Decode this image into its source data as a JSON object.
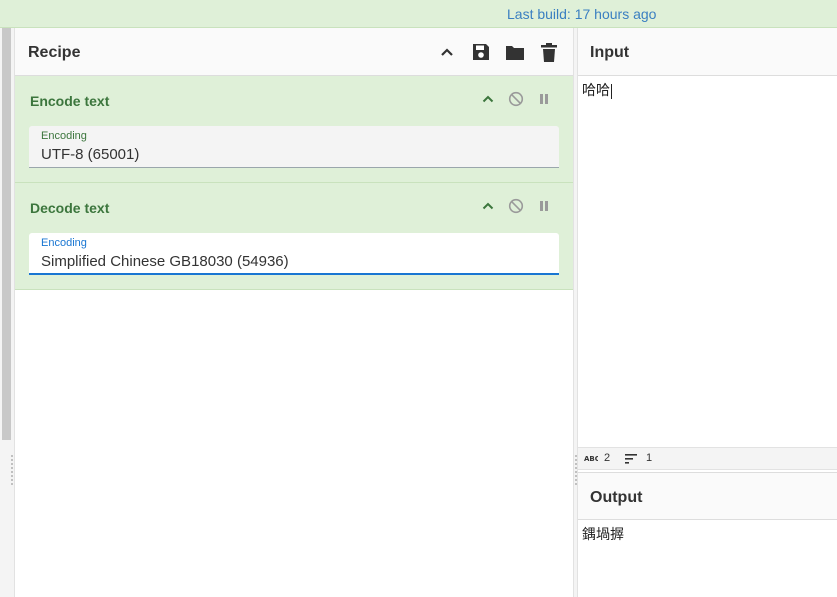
{
  "topbar": {
    "build_text": "Last build: 17 hours ago"
  },
  "recipe": {
    "title": "Recipe",
    "icons": [
      "chevron-up-icon",
      "save-icon",
      "folder-icon",
      "trash-icon"
    ],
    "operations": [
      {
        "title": "Encode text",
        "field_label": "Encoding",
        "field_value": "UTF-8 (65001)",
        "icons": [
          "chevron-up-icon",
          "disable-icon",
          "pause-icon"
        ]
      },
      {
        "title": "Decode text",
        "field_label": "Encoding",
        "field_value": "Simplified Chinese GB18030 (54936)",
        "icons": [
          "chevron-up-icon",
          "disable-icon",
          "pause-icon"
        ]
      }
    ]
  },
  "input": {
    "title": "Input",
    "text": "哈哈",
    "stats": {
      "length": "2",
      "lines": "1"
    }
  },
  "output": {
    "title": "Output",
    "text": "鍝堝搱"
  },
  "colors": {
    "accent": "#3c763d",
    "op_background": "#dff0d8",
    "link": "#3a7fc1",
    "focus": "#1976d2"
  }
}
